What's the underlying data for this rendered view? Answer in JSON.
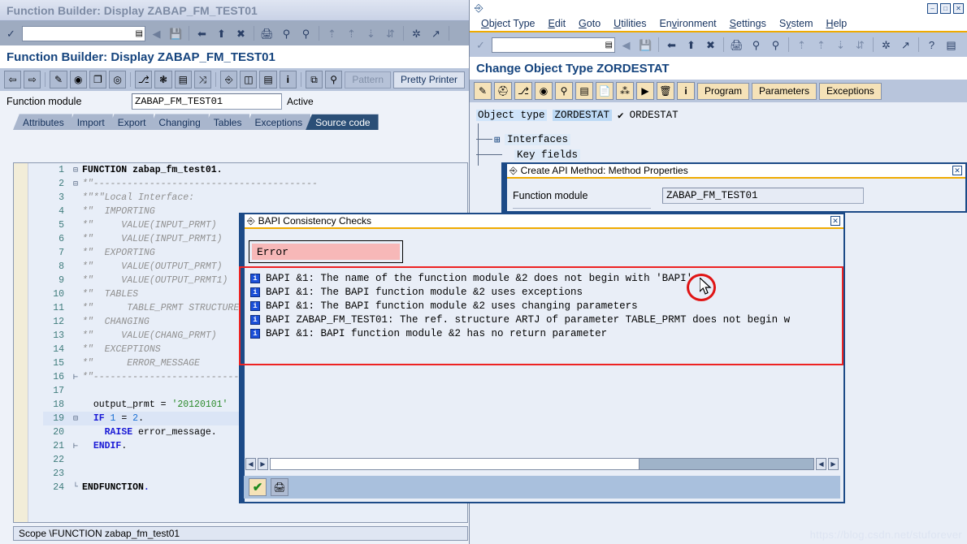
{
  "left_window": {
    "title": "Function Builder: Display ZABAP_FM_TEST01",
    "command_field_value": "",
    "app_title": "Function Builder: Display ZABAP_FM_TEST01",
    "toolbar_buttons": [
      {
        "name": "back-icon",
        "glyph": "⇦"
      },
      {
        "name": "forward-icon",
        "glyph": "⇨"
      },
      {
        "name": "display-change-icon",
        "glyph": "✎"
      },
      {
        "name": "check-objects-icon",
        "glyph": "◕"
      },
      {
        "name": "other-object-icon",
        "glyph": "❐"
      },
      {
        "name": "activate-icon",
        "glyph": "◎"
      },
      {
        "name": "where-used-icon",
        "glyph": "⎇"
      },
      {
        "name": "insert-statement-icon",
        "glyph": "✳"
      },
      {
        "name": "function-module-doc-icon",
        "glyph": "☰"
      },
      {
        "name": "expand-icon",
        "glyph": "⤢"
      },
      {
        "name": "hierarchy-icon",
        "glyph": "⑂"
      },
      {
        "name": "stack-icon",
        "glyph": "☰"
      },
      {
        "name": "list-icon",
        "glyph": "▤"
      },
      {
        "name": "info-icon",
        "glyph": "i"
      },
      {
        "name": "copy-icon",
        "glyph": "⧉"
      },
      {
        "name": "compare-icon",
        "glyph": "⚲"
      }
    ],
    "pattern_label": "Pattern",
    "pretty_printer_label": "Pretty Printer",
    "fm_label": "Function module",
    "fm_value": "ZABAP_FM_TEST01",
    "fm_status": "Active",
    "tabs": [
      {
        "label": "Attributes",
        "active": false
      },
      {
        "label": "Import",
        "active": false
      },
      {
        "label": "Export",
        "active": false
      },
      {
        "label": "Changing",
        "active": false
      },
      {
        "label": "Tables",
        "active": false
      },
      {
        "label": "Exceptions",
        "active": false
      },
      {
        "label": "Source code",
        "active": true
      }
    ],
    "scope_bar": "Scope \\FUNCTION zabap_fm_test01",
    "code_lines": [
      {
        "n": 1,
        "fold": "⊟",
        "html": "<span class='kwb'>FUNCTION</span> <span class='kwb'>zabap_fm_test01</span><span class='kwb'>.</span>"
      },
      {
        "n": 2,
        "fold": "⊟",
        "html": "<span class='cm'>*\"----------------------------------------</span>"
      },
      {
        "n": 3,
        "fold": "",
        "html": "<span class='cm'>*\"*\"Local Interface:</span>"
      },
      {
        "n": 4,
        "fold": "",
        "html": "<span class='cm'>*\"  IMPORTING</span>"
      },
      {
        "n": 5,
        "fold": "",
        "html": "<span class='cm'>*\"     VALUE(INPUT_PRMT)</span>"
      },
      {
        "n": 6,
        "fold": "",
        "html": "<span class='cm'>*\"     VALUE(INPUT_PRMT1)</span>"
      },
      {
        "n": 7,
        "fold": "",
        "html": "<span class='cm'>*\"  EXPORTING</span>"
      },
      {
        "n": 8,
        "fold": "",
        "html": "<span class='cm'>*\"     VALUE(OUTPUT_PRMT)</span>"
      },
      {
        "n": 9,
        "fold": "",
        "html": "<span class='cm'>*\"     VALUE(OUTPUT_PRMT1)</span>"
      },
      {
        "n": 10,
        "fold": "",
        "html": "<span class='cm'>*\"  TABLES</span>"
      },
      {
        "n": 11,
        "fold": "",
        "html": "<span class='cm'>*\"      TABLE_PRMT STRUCTURE</span>"
      },
      {
        "n": 12,
        "fold": "",
        "html": "<span class='cm'>*\"  CHANGING</span>"
      },
      {
        "n": 13,
        "fold": "",
        "html": "<span class='cm'>*\"     VALUE(CHANG_PRMT)</span>"
      },
      {
        "n": 14,
        "fold": "",
        "html": "<span class='cm'>*\"  EXCEPTIONS</span>"
      },
      {
        "n": 15,
        "fold": "",
        "html": "<span class='cm'>*\"      ERROR_MESSAGE</span>"
      },
      {
        "n": 16,
        "fold": "⊢",
        "html": "<span class='cm'>*\"----------------------------------------</span>"
      },
      {
        "n": 17,
        "fold": "",
        "html": ""
      },
      {
        "n": 18,
        "fold": "",
        "html": "  <span class='ctext'>output_prmt = </span><span class='str'>'20120101'</span>"
      },
      {
        "n": 19,
        "fold": "⊟",
        "html": "  <span class='kw'>IF</span> <span class='num'>1</span> <span class='ctext'>= </span><span class='num'>2</span><span class='ctext'>.</span>",
        "hl": true
      },
      {
        "n": 20,
        "fold": "",
        "html": "    <span class='kw'>RAISE</span> <span class='ctext'>error_message.</span>"
      },
      {
        "n": 21,
        "fold": "⊢",
        "html": "  <span class='kw'>ENDIF</span><span class='ctext'>.</span>"
      },
      {
        "n": 22,
        "fold": "",
        "html": ""
      },
      {
        "n": 23,
        "fold": "",
        "html": ""
      },
      {
        "n": 24,
        "fold": "└",
        "html": "<span class='kwb'>ENDFUNCTION</span><span class='kw'>.</span>"
      }
    ]
  },
  "right_window": {
    "menu": [
      {
        "label": "Object Type",
        "accel": "O"
      },
      {
        "label": "Edit",
        "accel": "E"
      },
      {
        "label": "Goto",
        "accel": "G"
      },
      {
        "label": "Utilities",
        "accel": "U"
      },
      {
        "label": "Environment",
        "accel": "v"
      },
      {
        "label": "Settings",
        "accel": "S"
      },
      {
        "label": "System",
        "accel": "y"
      },
      {
        "label": "Help",
        "accel": "H"
      }
    ],
    "window_buttons": [
      {
        "name": "minimize-button",
        "glyph": "–"
      },
      {
        "name": "maximize-button",
        "glyph": "□"
      },
      {
        "name": "close-button",
        "glyph": "✕"
      }
    ],
    "command_field_value": "",
    "app_title": "Change Object Type ZORDESTAT",
    "toolbar_buttons": [
      {
        "name": "display-change-icon",
        "glyph": "✎"
      },
      {
        "name": "hat-icon",
        "glyph": "⛑"
      },
      {
        "name": "where-used-icon",
        "glyph": "⎇"
      },
      {
        "name": "status-icon",
        "glyph": "◕"
      },
      {
        "name": "check-icon",
        "glyph": "⌕"
      },
      {
        "name": "program-icon",
        "glyph": "☰"
      },
      {
        "name": "new-icon",
        "glyph": "❐"
      },
      {
        "name": "api-methods-icon",
        "glyph": "⁂"
      },
      {
        "name": "execute-icon",
        "glyph": "▶"
      },
      {
        "name": "delete-icon",
        "glyph": "Ὕ1"
      },
      {
        "name": "info-icon",
        "glyph": "i"
      }
    ],
    "text_buttons": [
      "Program",
      "Parameters",
      "Exceptions"
    ],
    "object_type_label": "Object type",
    "object_type_value": "ZORDESTAT",
    "object_type_check": "✔",
    "object_type_desc": "ORDESTAT",
    "tree_nodes": [
      {
        "label": "Interfaces",
        "expander": "⊞"
      },
      {
        "label": "Key fields",
        "expander": ""
      }
    ]
  },
  "api_dialog": {
    "title": "Create API Method: Method Properties",
    "close_glyph": "✕",
    "field_label": "Function module",
    "field_value": "ZABAP_FM_TEST01"
  },
  "bapi_dialog": {
    "title": "BAPI Consistency Checks",
    "close_glyph": "✕",
    "error_tag": "Error",
    "messages": [
      "BAPI &1: The name of the function module &2 does not begin with 'BAPI'",
      "BAPI &1: The BAPI function module &2 uses exceptions",
      "BAPI &1: The BAPI function module &2 uses changing parameters",
      "BAPI ZABAP_FM_TEST01: The ref. structure ARTJ of parameter TABLE_PRMT does not begin w",
      "BAPI &1: BAPI function module &2 has no return parameter"
    ],
    "msg_icon_glyph": "i",
    "buttons": [
      {
        "name": "continue-button",
        "glyph": "✔"
      },
      {
        "name": "print-button",
        "glyph": "⎙"
      }
    ],
    "scroll_left_glyph": "◀",
    "scroll_right_glyph": "▶"
  },
  "watermark": "https://blog.csdn.net/stuforever",
  "colors": {
    "accent_orange": "#f0ab00",
    "title_blue": "#15447e",
    "error_red": "#ee2222",
    "highlight_blue": "#cfe4fa"
  }
}
